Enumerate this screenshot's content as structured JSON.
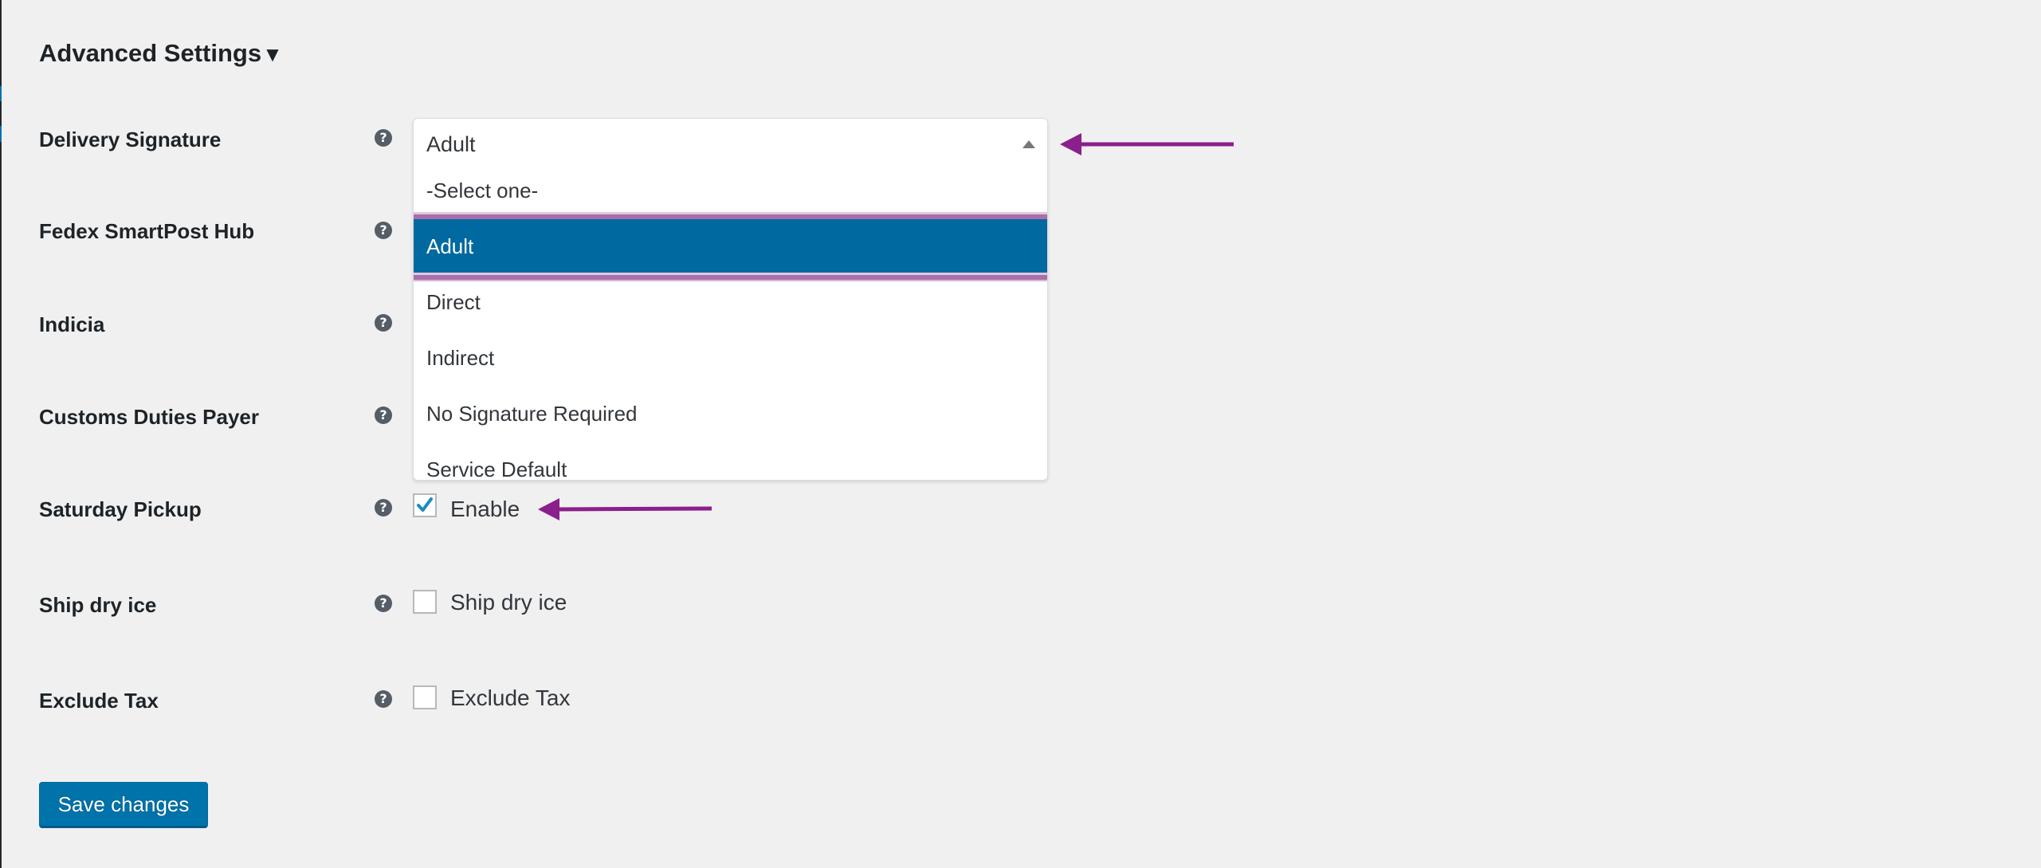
{
  "section": {
    "title": "Advanced Settings",
    "toggle_glyph": "▼"
  },
  "fields": [
    {
      "label": "Delivery Signature",
      "help_icon": "question-circle-icon",
      "type": "select"
    },
    {
      "label": "Fedex SmartPost Hub",
      "help_icon": "question-circle-icon",
      "type": "select"
    },
    {
      "label": "Indicia",
      "help_icon": "question-circle-icon",
      "type": "select"
    },
    {
      "label": "Customs Duties Payer",
      "help_icon": "question-circle-icon",
      "type": "select"
    },
    {
      "label": "Saturday Pickup",
      "help_icon": "question-circle-icon",
      "type": "checkbox",
      "checkbox_label": "Enable",
      "checked": true
    },
    {
      "label": "Ship dry ice",
      "help_icon": "question-circle-icon",
      "type": "checkbox",
      "checkbox_label": "Ship dry ice",
      "checked": false
    },
    {
      "label": "Exclude Tax",
      "help_icon": "question-circle-icon",
      "type": "checkbox",
      "checkbox_label": "Exclude Tax",
      "checked": false
    }
  ],
  "delivery_signature_dropdown": {
    "selected": "Adult",
    "open": true,
    "options": [
      "-Select one-",
      "Adult",
      "Direct",
      "Indirect",
      "No Signature Required",
      "Service Default"
    ],
    "highlighted_index": 1
  },
  "actions": {
    "save_label": "Save changes"
  },
  "colors": {
    "accent": "#0073aa",
    "highlight": "#0069a0",
    "annotation_arrow": "#8b1f8b",
    "background": "#f0f0f1"
  }
}
